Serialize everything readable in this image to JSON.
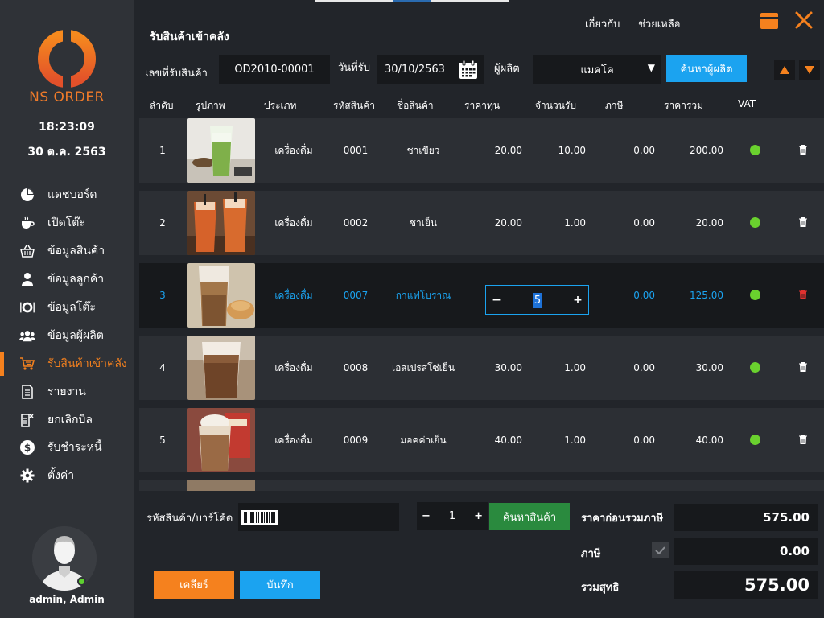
{
  "app": {
    "brand": "NS ORDER",
    "time": "18:23:09",
    "date": "30 ต.ค. 2563",
    "accent_color": "#f5811e",
    "highlight_color": "#1ba3f0",
    "user": "admin, Admin"
  },
  "sidebar": {
    "items": [
      {
        "label": "แดชบอร์ด",
        "icon": "pie-chart-icon"
      },
      {
        "label": "เปิดโต๊ะ",
        "icon": "coffee-cup-icon"
      },
      {
        "label": "ข้อมูลสินค้า",
        "icon": "basket-icon"
      },
      {
        "label": "ข้อมูลลูกค้า",
        "icon": "user-icon"
      },
      {
        "label": "ข้อมูลโต๊ะ",
        "icon": "plate-icon"
      },
      {
        "label": "ข้อมูลผู้ผลิต",
        "icon": "users-icon"
      },
      {
        "label": "รับสินค้าเข้าคลัง",
        "icon": "cart-icon",
        "active": true
      },
      {
        "label": "รายงาน",
        "icon": "report-icon"
      },
      {
        "label": "ยกเลิกบิล",
        "icon": "cancel-bill-icon"
      },
      {
        "label": "รับชำระหนี้",
        "icon": "coin-icon"
      },
      {
        "label": "ตั้งค่า",
        "icon": "gear-icon"
      }
    ]
  },
  "header": {
    "title": "รับสินค้าเข้าคลัง",
    "about": "เกี่ยวกับ",
    "help": "ช่วยเหลือ"
  },
  "filter": {
    "receipt_no_label": "เลขที่รับสินค้า",
    "receipt_no": "OD2010-00001",
    "date_label": "วันที่รับ",
    "date": "30/10/2563",
    "supplier_label": "ผู้ผลิต",
    "supplier": "แมคโค",
    "search_supplier": "ค้นหาผู้ผลิต"
  },
  "table": {
    "headers": [
      "ลำดับ",
      "รูปภาพ",
      "ประเภท",
      "รหัสสินค้า",
      "ชื่อสินค้า",
      "ราคาทุน",
      "จำนวนรับ",
      "ภาษี",
      "ราคารวม",
      "VAT"
    ],
    "rows": [
      {
        "no": "1",
        "type": "เครื่องดื่ม",
        "code": "0001",
        "name": "ชาเขียว",
        "cost": "20.00",
        "qty": "10.00",
        "tax": "0.00",
        "total": "200.00"
      },
      {
        "no": "2",
        "type": "เครื่องดื่ม",
        "code": "0002",
        "name": "ชาเย็น",
        "cost": "20.00",
        "qty": "1.00",
        "tax": "0.00",
        "total": "20.00"
      },
      {
        "no": "3",
        "type": "เครื่องดื่ม",
        "code": "0007",
        "name": "กาแฟโบราณ",
        "cost": "",
        "qty": "5",
        "tax": "0.00",
        "total": "125.00",
        "selected": true
      },
      {
        "no": "4",
        "type": "เครื่องดื่ม",
        "code": "0008",
        "name": "เอสเปรสโซ่เย็น",
        "cost": "30.00",
        "qty": "1.00",
        "tax": "0.00",
        "total": "30.00"
      },
      {
        "no": "5",
        "type": "เครื่องดื่ม",
        "code": "0009",
        "name": "มอคค่าเย็น",
        "cost": "40.00",
        "qty": "1.00",
        "tax": "0.00",
        "total": "40.00"
      }
    ]
  },
  "bottom": {
    "barcode_label": "รหัสสินค้า/บาร์โค้ด",
    "qty": "1",
    "search_product": "ค้นหาสินค้า",
    "subtotal_label": "ราคาก่อนรวมภาษี",
    "subtotal": "575.00",
    "tax_label": "ภาษี",
    "tax": "0.00",
    "total_label": "รวมสุทธิ",
    "total": "575.00",
    "clear": "เคลียร์",
    "save": "บันทึก"
  }
}
